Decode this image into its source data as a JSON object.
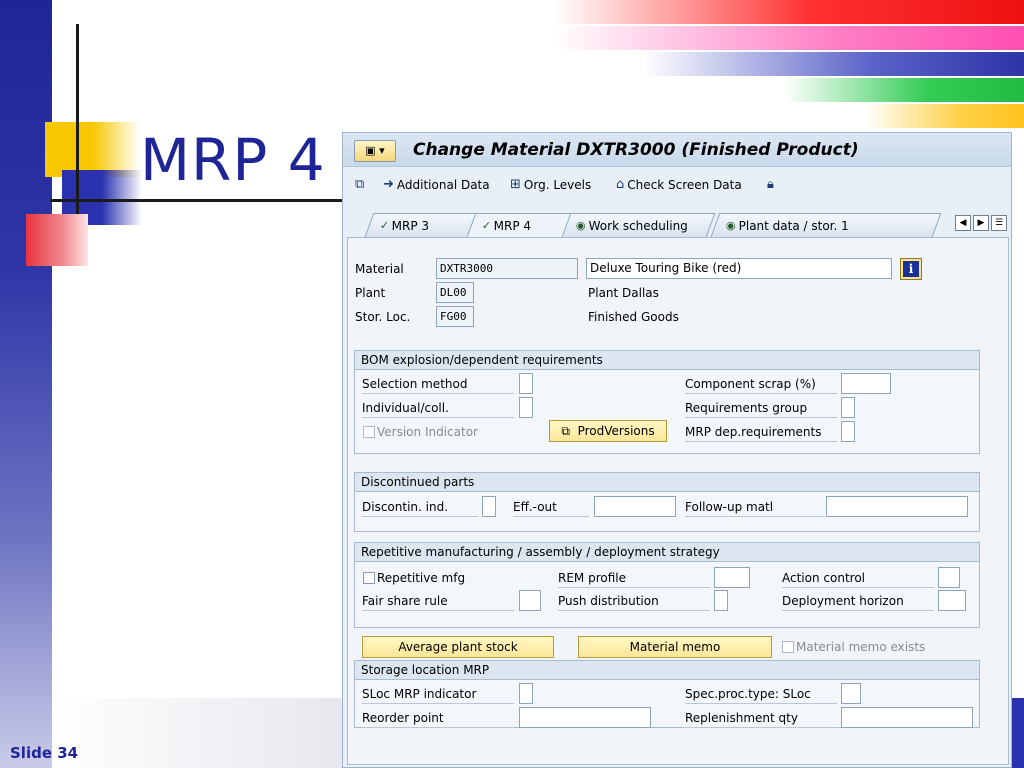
{
  "slide": {
    "title": "MRP 4",
    "footer": "Slide 34"
  },
  "window": {
    "menu_icon": "menu-icon",
    "title": "Change Material DXTR3000 (Finished Product)"
  },
  "toolbar": {
    "additional_data": "Additional Data",
    "org_levels": "Org. Levels",
    "check_screen_data": "Check Screen Data"
  },
  "tabs": [
    {
      "label": "MRP 3",
      "active": false
    },
    {
      "label": "MRP 4",
      "active": true
    },
    {
      "label": "Work scheduling",
      "active": false
    },
    {
      "label": "Plant data / stor. 1",
      "active": false
    }
  ],
  "header": {
    "material_label": "Material",
    "material_value": "DXTR3000",
    "material_desc": "Deluxe Touring Bike (red)",
    "plant_label": "Plant",
    "plant_value": "DL00",
    "plant_desc": "Plant Dallas",
    "storloc_label": "Stor. Loc.",
    "storloc_value": "FG00",
    "storloc_desc": "Finished Goods"
  },
  "bom": {
    "title": "BOM explosion/dependent requirements",
    "selection_method": "Selection method",
    "individual_coll": "Individual/coll.",
    "version_indicator": "Version Indicator",
    "prodversions": "ProdVersions",
    "component_scrap": "Component scrap (%)",
    "requirements_group": "Requirements group",
    "mrp_dep_requirements": "MRP dep.requirements"
  },
  "discontinued": {
    "title": "Discontinued parts",
    "discontin_ind": "Discontin. ind.",
    "eff_out": "Eff.-out",
    "follow_up": "Follow-up matl"
  },
  "repetitive": {
    "title": "Repetitive manufacturing / assembly / deployment strategy",
    "repetitive_mfg": "Repetitive mfg",
    "rem_profile": "REM profile",
    "action_control": "Action control",
    "fair_share_rule": "Fair share rule",
    "push_distribution": "Push distribution",
    "deployment_horizon": "Deployment horizon"
  },
  "buttons": {
    "avg_plant_stock": "Average plant stock",
    "material_memo": "Material memo",
    "material_memo_exists": "Material memo exists"
  },
  "storage": {
    "title": "Storage location MRP",
    "sloc_mrp_indicator": "SLoc MRP indicator",
    "spec_proc_type": "Spec.proc.type: SLoc",
    "reorder_point": "Reorder point",
    "replenishment_qty": "Replenishment qty"
  }
}
